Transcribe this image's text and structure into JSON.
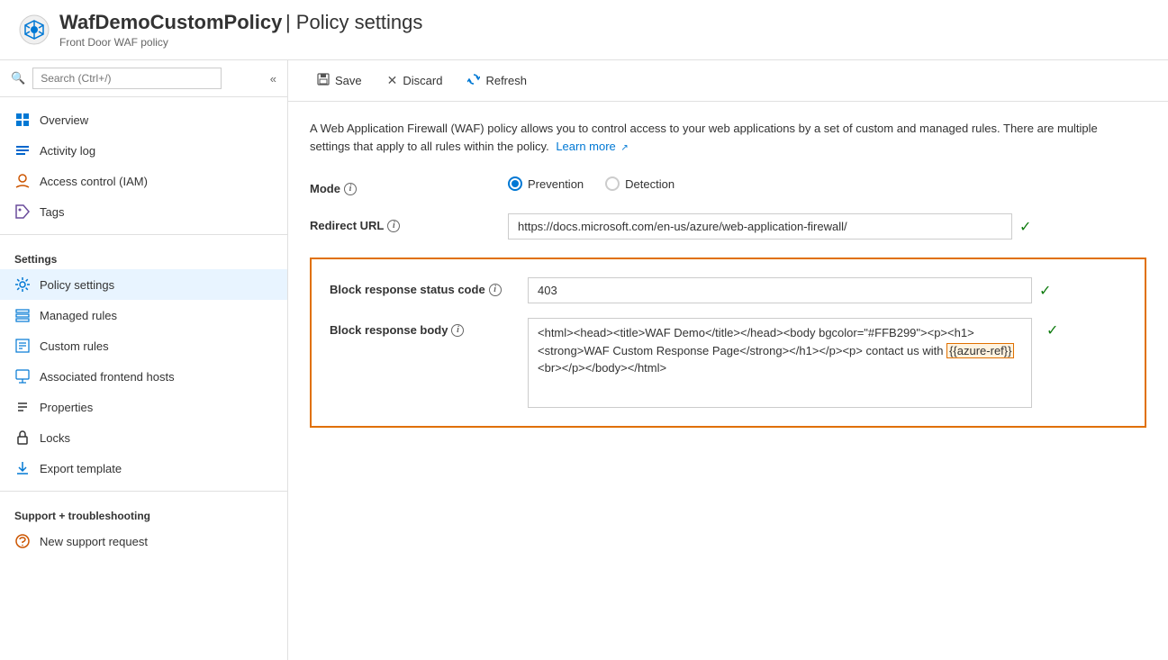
{
  "header": {
    "title": "WafDemoCustomPolicy",
    "separator": " | ",
    "subtitle_page": "Policy settings",
    "subtitle_detail": "Front Door WAF policy",
    "icon": "gear"
  },
  "sidebar": {
    "search_placeholder": "Search (Ctrl+/)",
    "collapse_title": "Collapse",
    "nav_items": [
      {
        "id": "overview",
        "label": "Overview",
        "icon": "home"
      },
      {
        "id": "activity-log",
        "label": "Activity log",
        "icon": "activity"
      },
      {
        "id": "access-control",
        "label": "Access control (IAM)",
        "icon": "person"
      },
      {
        "id": "tags",
        "label": "Tags",
        "icon": "tag"
      }
    ],
    "settings_section": "Settings",
    "settings_items": [
      {
        "id": "policy-settings",
        "label": "Policy settings",
        "icon": "settings",
        "active": true
      },
      {
        "id": "managed-rules",
        "label": "Managed rules",
        "icon": "managed"
      },
      {
        "id": "custom-rules",
        "label": "Custom rules",
        "icon": "custom"
      },
      {
        "id": "associated-frontend",
        "label": "Associated frontend hosts",
        "icon": "frontend"
      },
      {
        "id": "properties",
        "label": "Properties",
        "icon": "properties"
      },
      {
        "id": "locks",
        "label": "Locks",
        "icon": "lock"
      },
      {
        "id": "export-template",
        "label": "Export template",
        "icon": "export"
      }
    ],
    "support_section": "Support + troubleshooting",
    "support_items": [
      {
        "id": "new-support",
        "label": "New support request",
        "icon": "support"
      }
    ]
  },
  "toolbar": {
    "save_label": "Save",
    "discard_label": "Discard",
    "refresh_label": "Refresh"
  },
  "content": {
    "description": "A Web Application Firewall (WAF) policy allows you to control access to your web applications by a set of custom and managed rules. There are multiple settings that apply to all rules within the policy.",
    "learn_more": "Learn more",
    "mode_label": "Mode",
    "mode_options": [
      {
        "id": "prevention",
        "label": "Prevention",
        "checked": true
      },
      {
        "id": "detection",
        "label": "Detection",
        "checked": false
      }
    ],
    "redirect_url_label": "Redirect URL",
    "redirect_url_value": "https://docs.microsoft.com/en-us/azure/web-application-firewall/",
    "block_status_code_label": "Block response status code",
    "block_status_code_value": "403",
    "block_body_label": "Block response body",
    "block_body_value": "<html><head><title>WAF Demo</title></head><body bgcolor=\"#FFB299\"><p><h1><strong>WAF Custom Response Page</strong></h1></p><p> contact us with {{azure-ref}} <br></p></body></html>",
    "block_body_display_parts": [
      {
        "text": "<html><head><title>WAF Demo</title></head><body bgcolor=\"#FFB299\"><p><h1><strong>WAF Custom Response Page</strong></h1></p><p> contact us with ",
        "highlight": false
      },
      {
        "text": "{{azure-ref}}",
        "highlight": true
      },
      {
        "text": " <br></p></body></html>",
        "highlight": false
      }
    ]
  }
}
